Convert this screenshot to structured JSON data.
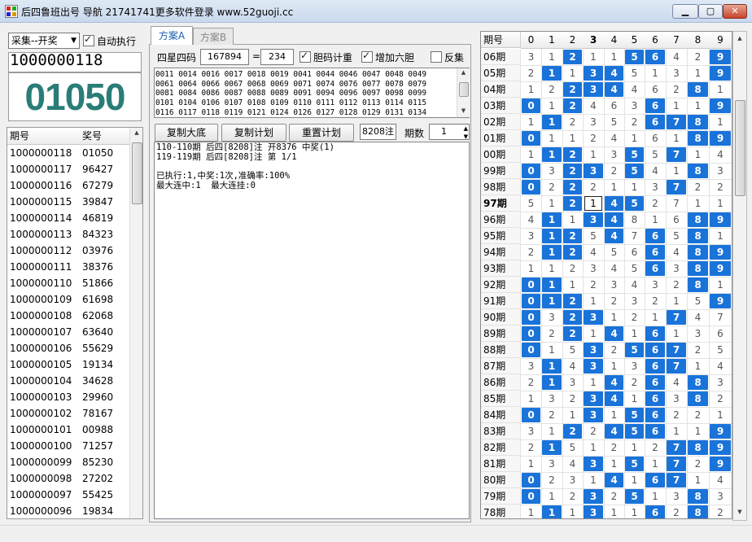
{
  "window": {
    "title": "后四鲁班出号 导航 21741741更多软件登录 www.52guoji.cc",
    "colors": {
      "accent": "#1a73d9",
      "big_number": "#2a7d77"
    }
  },
  "left": {
    "collect_select": "采集--开奖",
    "auto_exec_label": "自动执行",
    "current_period": "1000000118",
    "current_number": "01050",
    "list_headers": [
      "期号",
      "奖号"
    ],
    "rows": [
      [
        "1000000118",
        "01050"
      ],
      [
        "1000000117",
        "96427"
      ],
      [
        "1000000116",
        "67279"
      ],
      [
        "1000000115",
        "39847"
      ],
      [
        "1000000114",
        "46819"
      ],
      [
        "1000000113",
        "84323"
      ],
      [
        "1000000112",
        "03976"
      ],
      [
        "1000000111",
        "38376"
      ],
      [
        "1000000110",
        "51866"
      ],
      [
        "1000000109",
        "61698"
      ],
      [
        "1000000108",
        "62068"
      ],
      [
        "1000000107",
        "63640"
      ],
      [
        "1000000106",
        "55629"
      ],
      [
        "1000000105",
        "19134"
      ],
      [
        "1000000104",
        "34628"
      ],
      [
        "1000000103",
        "29960"
      ],
      [
        "1000000102",
        "78167"
      ],
      [
        "1000000101",
        "00988"
      ],
      [
        "1000000100",
        "71257"
      ],
      [
        "1000000099",
        "85230"
      ],
      [
        "1000000098",
        "27202"
      ],
      [
        "1000000097",
        "55425"
      ],
      [
        "1000000096",
        "19834"
      ]
    ]
  },
  "middle": {
    "tabs": [
      "方案A",
      "方案B"
    ],
    "sixing_label": "四星四码",
    "code_input": "167894",
    "eq": "=",
    "count_input": "234",
    "checkboxes": [
      {
        "label": "胆码计重",
        "checked": true
      },
      {
        "label": "增加六胆",
        "checked": true
      },
      {
        "label": "反集",
        "checked": false
      }
    ],
    "codes_lines": [
      "0011 0014 0016 0017 0018 0019 0041 0044 0046 0047 0048 0049",
      "0061 0064 0066 0067 0068 0069 0071 0074 0076 0077 0078 0079",
      "0081 0084 0086 0087 0088 0089 0091 0094 0096 0097 0098 0099",
      "0101 0104 0106 0107 0108 0109 0110 0111 0112 0113 0114 0115",
      "0116 0117 0118 0119 0121 0124 0126 0127 0128 0129 0131 0134"
    ],
    "buttons": [
      "复制大底",
      "复制计划",
      "重置计划"
    ],
    "zhu_count": "8208注",
    "periods_label": "期数",
    "periods_value": "1",
    "log_lines": [
      "110-110期 后四[8208]注 开8376 中奖(1)",
      "119-119期 后四[8208]注 第 1/1",
      "",
      "已执行:1,中奖:1次,准确率:100%",
      "最大连中:1  最大连挂:0"
    ]
  },
  "grid": {
    "headers": [
      "期号",
      "0",
      "1",
      "2",
      "3",
      "4",
      "5",
      "6",
      "7",
      "8",
      "9"
    ],
    "rows": [
      {
        "label": "06期",
        "cells": [
          "3",
          "1",
          "2",
          "1",
          "1",
          "5",
          "6",
          "4",
          "2",
          "9"
        ],
        "hits": [
          2,
          5,
          6,
          9
        ]
      },
      {
        "label": "05期",
        "cells": [
          "2",
          "1",
          "1",
          "3",
          "4",
          "5",
          "1",
          "3",
          "1",
          "9"
        ],
        "hits": [
          1,
          3,
          4,
          9
        ]
      },
      {
        "label": "04期",
        "cells": [
          "1",
          "2",
          "2",
          "3",
          "4",
          "4",
          "6",
          "2",
          "8",
          "1"
        ],
        "hits": [
          2,
          3,
          4,
          8
        ]
      },
      {
        "label": "03期",
        "cells": [
          "0",
          "1",
          "2",
          "4",
          "6",
          "3",
          "6",
          "1",
          "1",
          "9"
        ],
        "hits": [
          0,
          2,
          6,
          9
        ]
      },
      {
        "label": "02期",
        "cells": [
          "1",
          "1",
          "2",
          "3",
          "5",
          "2",
          "6",
          "7",
          "8",
          "1"
        ],
        "hits": [
          1,
          6,
          7,
          8
        ]
      },
      {
        "label": "01期",
        "cells": [
          "0",
          "1",
          "1",
          "2",
          "4",
          "1",
          "6",
          "1",
          "8",
          "9"
        ],
        "hits": [
          0,
          8,
          9
        ]
      },
      {
        "label": "00期",
        "cells": [
          "1",
          "1",
          "2",
          "1",
          "3",
          "5",
          "5",
          "7",
          "1",
          "4"
        ],
        "hits": [
          1,
          2,
          5,
          7
        ]
      },
      {
        "label": "99期",
        "cells": [
          "0",
          "3",
          "2",
          "3",
          "2",
          "5",
          "4",
          "1",
          "8",
          "3"
        ],
        "hits": [
          0,
          2,
          3,
          5,
          8
        ]
      },
      {
        "label": "98期",
        "cells": [
          "0",
          "2",
          "2",
          "2",
          "1",
          "1",
          "3",
          "7",
          "2",
          "2"
        ],
        "hits": [
          0,
          2,
          7
        ]
      },
      {
        "label": "97期",
        "cells": [
          "5",
          "1",
          "2",
          "1",
          "4",
          "5",
          "2",
          "7",
          "1",
          "1"
        ],
        "hits": [
          2,
          4,
          5
        ],
        "bold": true,
        "cur": 3
      },
      {
        "label": "96期",
        "cells": [
          "4",
          "1",
          "1",
          "3",
          "4",
          "8",
          "1",
          "6",
          "8",
          "9"
        ],
        "hits": [
          1,
          3,
          4,
          8,
          9
        ]
      },
      {
        "label": "95期",
        "cells": [
          "3",
          "1",
          "2",
          "5",
          "4",
          "7",
          "6",
          "5",
          "8",
          "1"
        ],
        "hits": [
          1,
          2,
          4,
          6,
          8
        ]
      },
      {
        "label": "94期",
        "cells": [
          "2",
          "1",
          "2",
          "4",
          "5",
          "6",
          "6",
          "4",
          "8",
          "9"
        ],
        "hits": [
          1,
          2,
          6,
          8,
          9
        ]
      },
      {
        "label": "93期",
        "cells": [
          "1",
          "1",
          "2",
          "3",
          "4",
          "5",
          "6",
          "3",
          "8",
          "9"
        ],
        "hits": [
          6,
          8,
          9
        ]
      },
      {
        "label": "92期",
        "cells": [
          "0",
          "1",
          "1",
          "2",
          "3",
          "4",
          "3",
          "2",
          "8",
          "1"
        ],
        "hits": [
          0,
          1,
          8
        ]
      },
      {
        "label": "91期",
        "cells": [
          "0",
          "1",
          "2",
          "1",
          "2",
          "3",
          "2",
          "1",
          "5",
          "9"
        ],
        "hits": [
          0,
          1,
          2,
          9
        ]
      },
      {
        "label": "90期",
        "cells": [
          "0",
          "3",
          "2",
          "3",
          "1",
          "2",
          "1",
          "7",
          "4",
          "7"
        ],
        "hits": [
          0,
          2,
          3,
          7
        ]
      },
      {
        "label": "89期",
        "cells": [
          "0",
          "2",
          "2",
          "1",
          "4",
          "1",
          "6",
          "1",
          "3",
          "6"
        ],
        "hits": [
          0,
          2,
          4,
          6
        ]
      },
      {
        "label": "88期",
        "cells": [
          "0",
          "1",
          "5",
          "3",
          "2",
          "5",
          "6",
          "7",
          "2",
          "5"
        ],
        "hits": [
          0,
          3,
          5,
          6,
          7
        ]
      },
      {
        "label": "87期",
        "cells": [
          "3",
          "1",
          "4",
          "3",
          "1",
          "3",
          "6",
          "7",
          "1",
          "4"
        ],
        "hits": [
          1,
          3,
          6,
          7
        ]
      },
      {
        "label": "86期",
        "cells": [
          "2",
          "1",
          "3",
          "1",
          "4",
          "2",
          "6",
          "4",
          "8",
          "3"
        ],
        "hits": [
          1,
          4,
          6,
          8
        ]
      },
      {
        "label": "85期",
        "cells": [
          "1",
          "3",
          "2",
          "3",
          "4",
          "1",
          "6",
          "3",
          "8",
          "2"
        ],
        "hits": [
          3,
          4,
          6,
          8
        ]
      },
      {
        "label": "84期",
        "cells": [
          "0",
          "2",
          "1",
          "3",
          "1",
          "5",
          "6",
          "2",
          "2",
          "1"
        ],
        "hits": [
          0,
          3,
          5,
          6
        ]
      },
      {
        "label": "83期",
        "cells": [
          "3",
          "1",
          "2",
          "2",
          "4",
          "5",
          "6",
          "1",
          "1",
          "9"
        ],
        "hits": [
          2,
          4,
          5,
          6,
          9
        ]
      },
      {
        "label": "82期",
        "cells": [
          "2",
          "1",
          "5",
          "1",
          "2",
          "1",
          "2",
          "7",
          "8",
          "9"
        ],
        "hits": [
          1,
          7,
          8,
          9
        ]
      },
      {
        "label": "81期",
        "cells": [
          "1",
          "3",
          "4",
          "3",
          "1",
          "5",
          "1",
          "7",
          "2",
          "9"
        ],
        "hits": [
          3,
          5,
          7,
          9
        ]
      },
      {
        "label": "80期",
        "cells": [
          "0",
          "2",
          "3",
          "1",
          "4",
          "1",
          "6",
          "7",
          "1",
          "4"
        ],
        "hits": [
          0,
          4,
          6,
          7
        ]
      },
      {
        "label": "79期",
        "cells": [
          "0",
          "1",
          "2",
          "3",
          "2",
          "5",
          "1",
          "3",
          "8",
          "3"
        ],
        "hits": [
          0,
          3,
          5,
          8
        ]
      },
      {
        "label": "78期",
        "cells": [
          "1",
          "1",
          "1",
          "3",
          "1",
          "1",
          "6",
          "2",
          "8",
          "2"
        ],
        "hits": [
          1,
          3,
          6,
          8
        ]
      }
    ]
  }
}
